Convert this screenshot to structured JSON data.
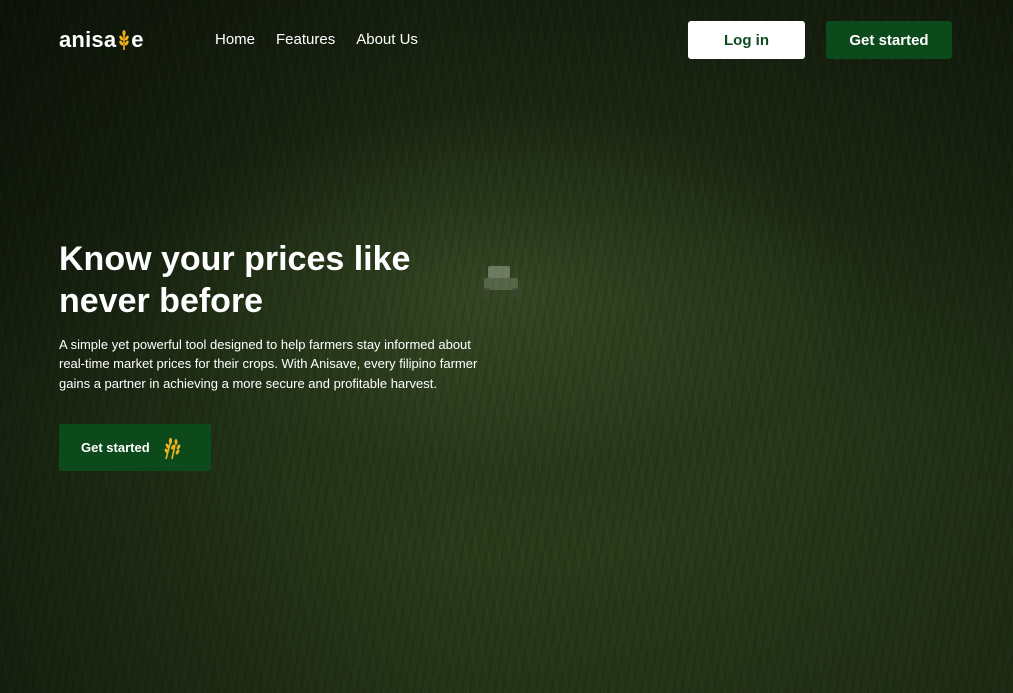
{
  "brand": {
    "name_prefix": "anisa",
    "name_suffix": "e",
    "icon": "wheat-icon",
    "icon_color": "#f2b21c"
  },
  "nav": {
    "links": [
      {
        "label": "Home"
      },
      {
        "label": "Features"
      },
      {
        "label": "About Us"
      }
    ],
    "login_label": "Log in",
    "get_started_label": "Get started"
  },
  "hero": {
    "title": "Know your prices like never before",
    "description": "A simple yet powerful tool designed to help farmers stay informed about real-time market prices for their crops. With Anisave, every filipino farmer gains a partner in achieving a more secure and profitable harvest.",
    "cta_label": "Get started",
    "cta_icon": "wheat-icon"
  },
  "colors": {
    "primary_green": "#0c4a1c",
    "login_text": "#0f4d1f",
    "accent_gold": "#f2b21c"
  }
}
